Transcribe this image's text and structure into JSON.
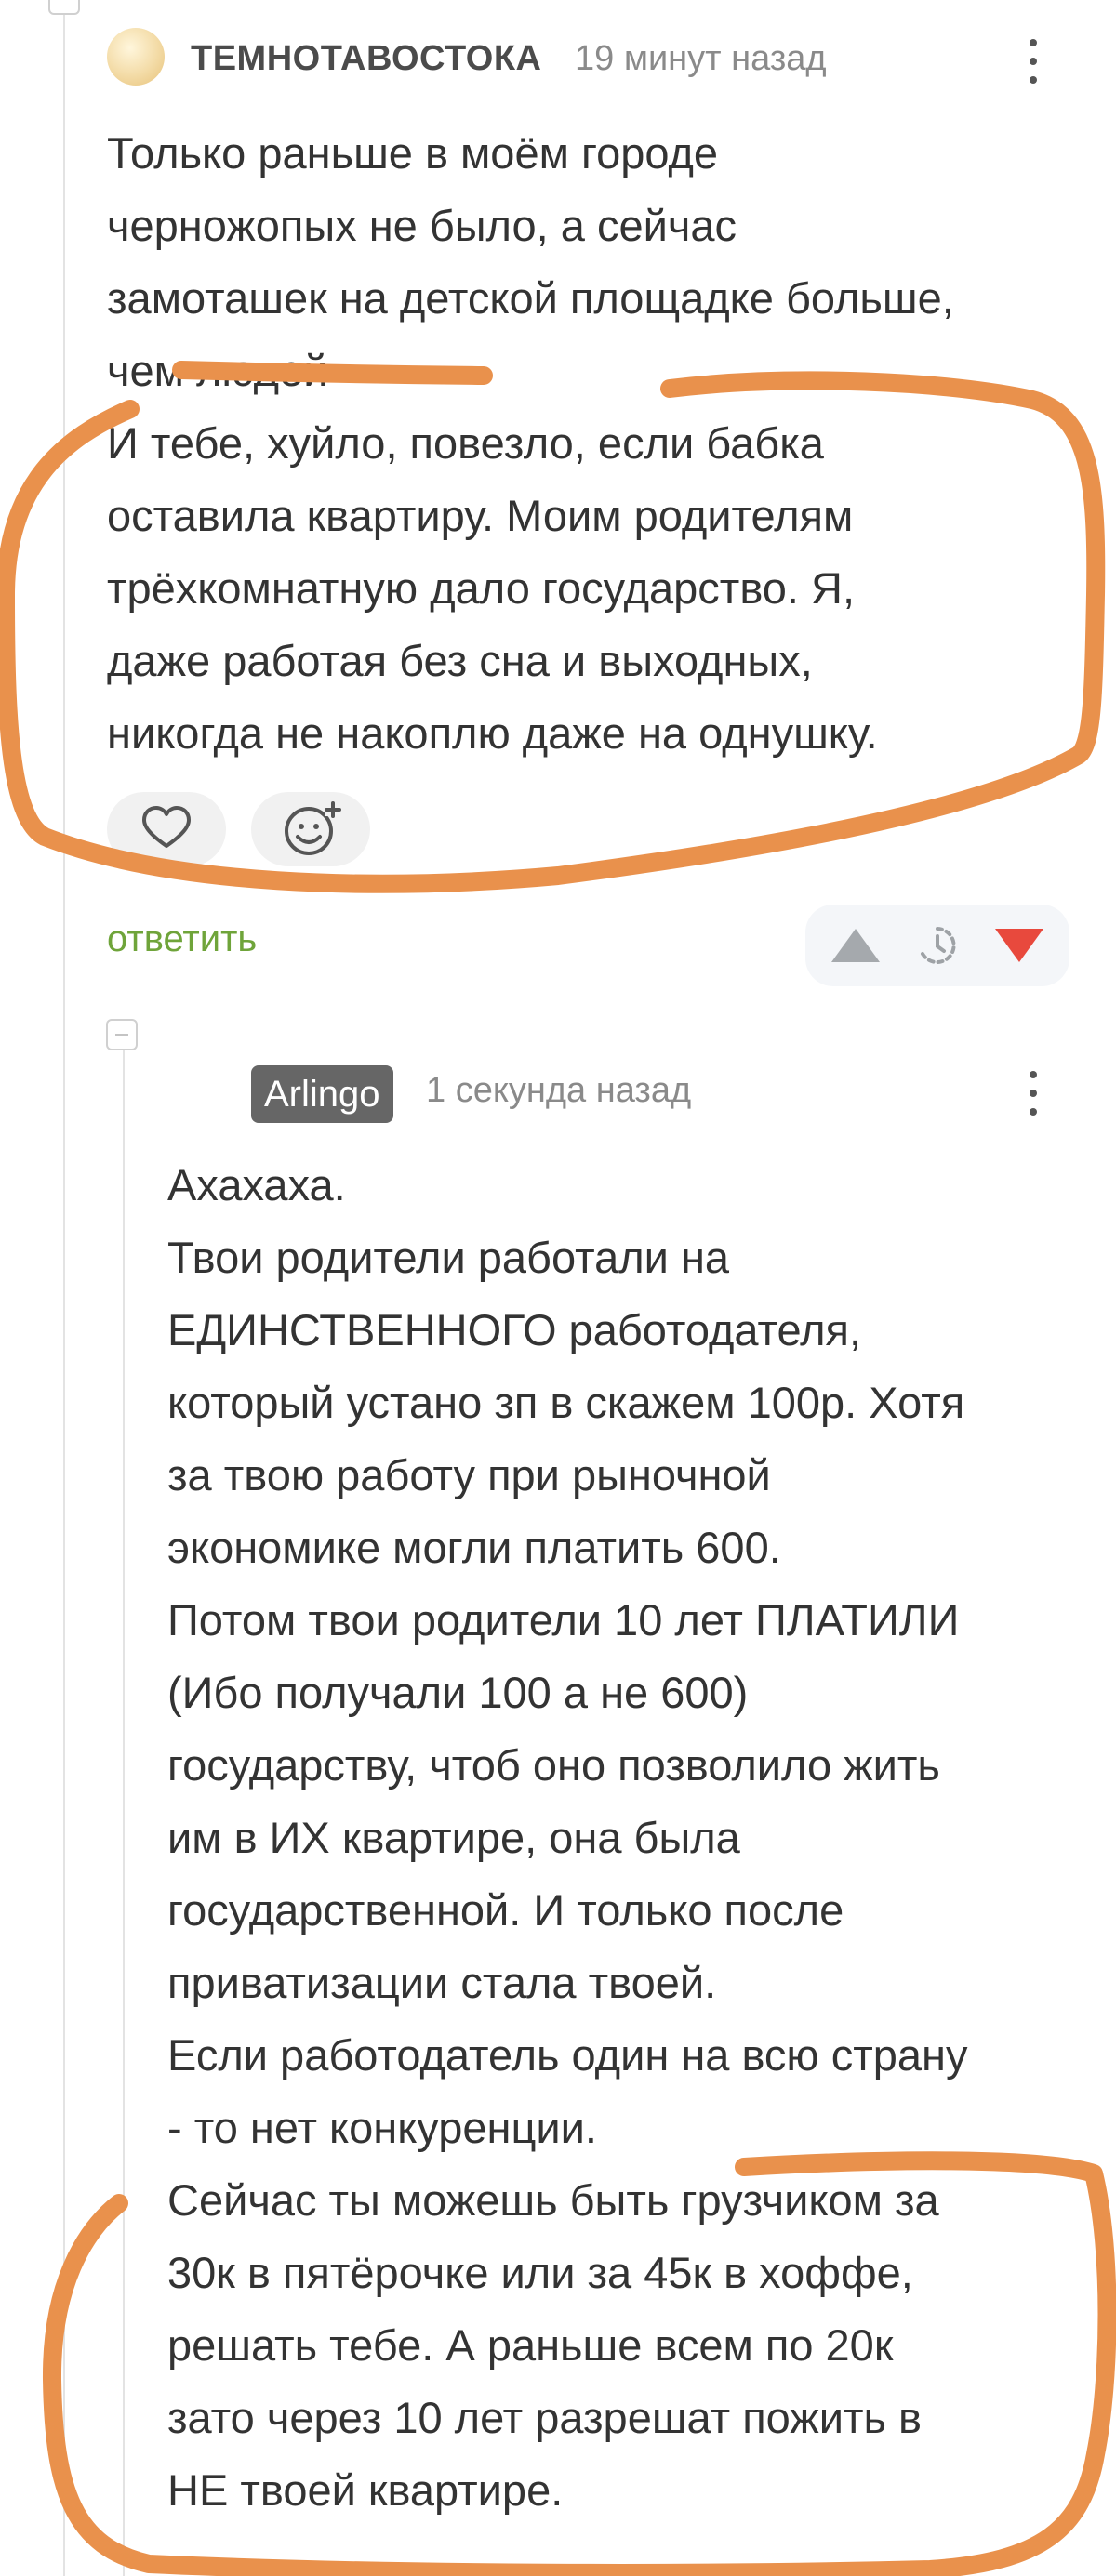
{
  "comment1": {
    "author": "ТЕМНОТАВОСТОКА",
    "time": "19 минут назад",
    "lines": [
      "Только раньше в моём городе",
      "черножопых не было, а сейчас",
      "замоташек на детской площадке больше,",
      "чем людей",
      "И тебе, хуйло, повезло, если бабка",
      "оставила квартиру. Моим родителям",
      "трёхкомнатную дало государство. Я,",
      "даже работая без сна и выходных,",
      "никогда не накоплю даже на однушку."
    ],
    "reply_label": "ответить"
  },
  "comment2": {
    "author": "Arlingo",
    "time": "1 секунда назад",
    "lines": [
      "Ахахаха.",
      "Твои родители работали на",
      "ЕДИНСТВЕННОГО работодателя,",
      "который устано зп в скажем 100р. Хотя",
      "за твою работу при рыночной",
      "экономике могли платить 600.",
      "Потом твои родители 10 лет ПЛАТИЛИ",
      "(Ибо получали 100 а не 600)",
      "государству, чтоб оно позволило жить",
      "им в ИХ квартире, она была",
      "государственной. И только после",
      "приватизации стала твоей.",
      "Если работодатель один на всю страну",
      "- то нет конкуренции.",
      "Сейчас ты можешь быть грузчиком за",
      "30к в пятёрочке или за 45к в хоффе,",
      "решать тебе. А раньше всем по 20к",
      "зато через 10 лет разрешат пожить в",
      "НЕ твоей квартире."
    ]
  },
  "icons": {
    "heart": "heart-icon",
    "add_reaction": "add-reaction-icon",
    "upvote": "upvote-icon",
    "save": "save-icon",
    "downvote": "downvote-icon",
    "more": "more-vertical-icon",
    "collapse": "collapse-icon"
  },
  "colors": {
    "reply_link": "#6fa43a",
    "upvote": "#a5a9ad",
    "downvote": "#e8493d",
    "annotation": "#e9914c",
    "badge_bg": "#666666"
  }
}
